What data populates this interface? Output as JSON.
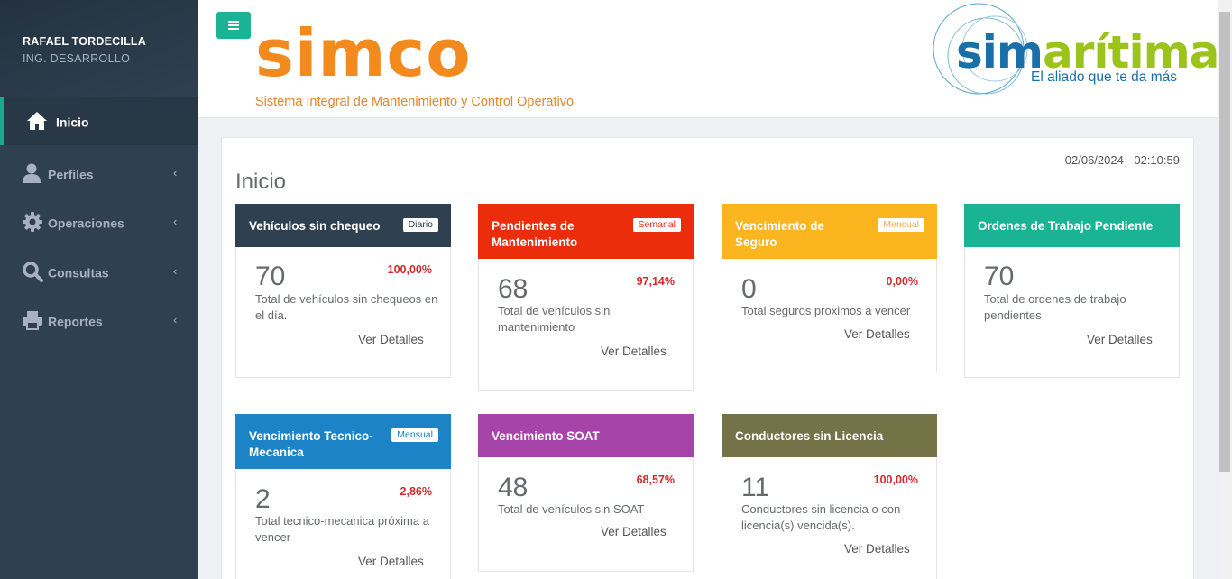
{
  "sidebar": {
    "user_name": "RAFAEL TORDECILLA",
    "user_role": "ING. DESARROLLO",
    "items": [
      {
        "label": "Inicio",
        "icon": "home-icon"
      },
      {
        "label": "Perfiles",
        "icon": "user-icon"
      },
      {
        "label": "Operaciones",
        "icon": "gear-icon"
      },
      {
        "label": "Consultas",
        "icon": "search-icon"
      },
      {
        "label": "Reportes",
        "icon": "printer-icon"
      }
    ],
    "chevron": "‹"
  },
  "header": {
    "app_name": "simco",
    "app_subtitle": "Sistema Integral de Mantenimiento y Control Operativo",
    "brand_main_a": "sim",
    "brand_main_b": "arítima",
    "brand_tagline": "El aliado que te da más"
  },
  "main": {
    "datetime": "02/06/2024 - 02:10:59",
    "title": "Inicio",
    "cards": [
      {
        "title": "Vehículos sin chequeo",
        "badge": "Diario",
        "value": "70",
        "percent": "100,00%",
        "description": "Total de vehículos sin chequeos en el día.",
        "link": "Ver Detalles",
        "color": "#2f4050",
        "badge_color": "#2f4050"
      },
      {
        "title": "Pendientes de Mantenimiento",
        "badge": "Semanal",
        "value": "68",
        "percent": "97,14%",
        "description": "Total de vehículos sin mantenimiento",
        "link": "Ver Detalles",
        "color": "#ec2d0c",
        "badge_color": "#ec2d0c"
      },
      {
        "title": "Vencimiento de Seguro",
        "badge": "Mensual",
        "value": "0",
        "percent": "0,00%",
        "description": "Total seguros proximos a vencer",
        "link": "Ver Detalles",
        "color": "#fbb51e",
        "badge_color": "#f8ac59"
      },
      {
        "title": "Ordenes de Trabajo Pendiente",
        "badge": "",
        "value": "70",
        "percent": "",
        "description": "Total de ordenes de trabajo pendientes",
        "link": "Ver Detalles",
        "color": "#1ab394",
        "badge_color": ""
      },
      {
        "title": "Vencimiento Tecnico-Mecanica",
        "badge": "Mensual",
        "value": "2",
        "percent": "2,86%",
        "description": "Total tecnico-mecanica próxima a vencer",
        "link": "Ver Detalles",
        "color": "#1c84c6",
        "badge_color": "#1c84c6"
      },
      {
        "title": "Vencimiento SOAT",
        "badge": "",
        "value": "48",
        "percent": "68,57%",
        "description": "Total de vehículos sin SOAT",
        "link": "Ver Detalles",
        "color": "#a644aa",
        "badge_color": ""
      },
      {
        "title": "Conductores sin Licencia",
        "badge": "",
        "value": "11",
        "percent": "100,00%",
        "description": "Conductores sin licencia o con licencia(s) vencida(s).",
        "link": "Ver Detalles",
        "color": "#747247",
        "badge_color": ""
      }
    ]
  }
}
